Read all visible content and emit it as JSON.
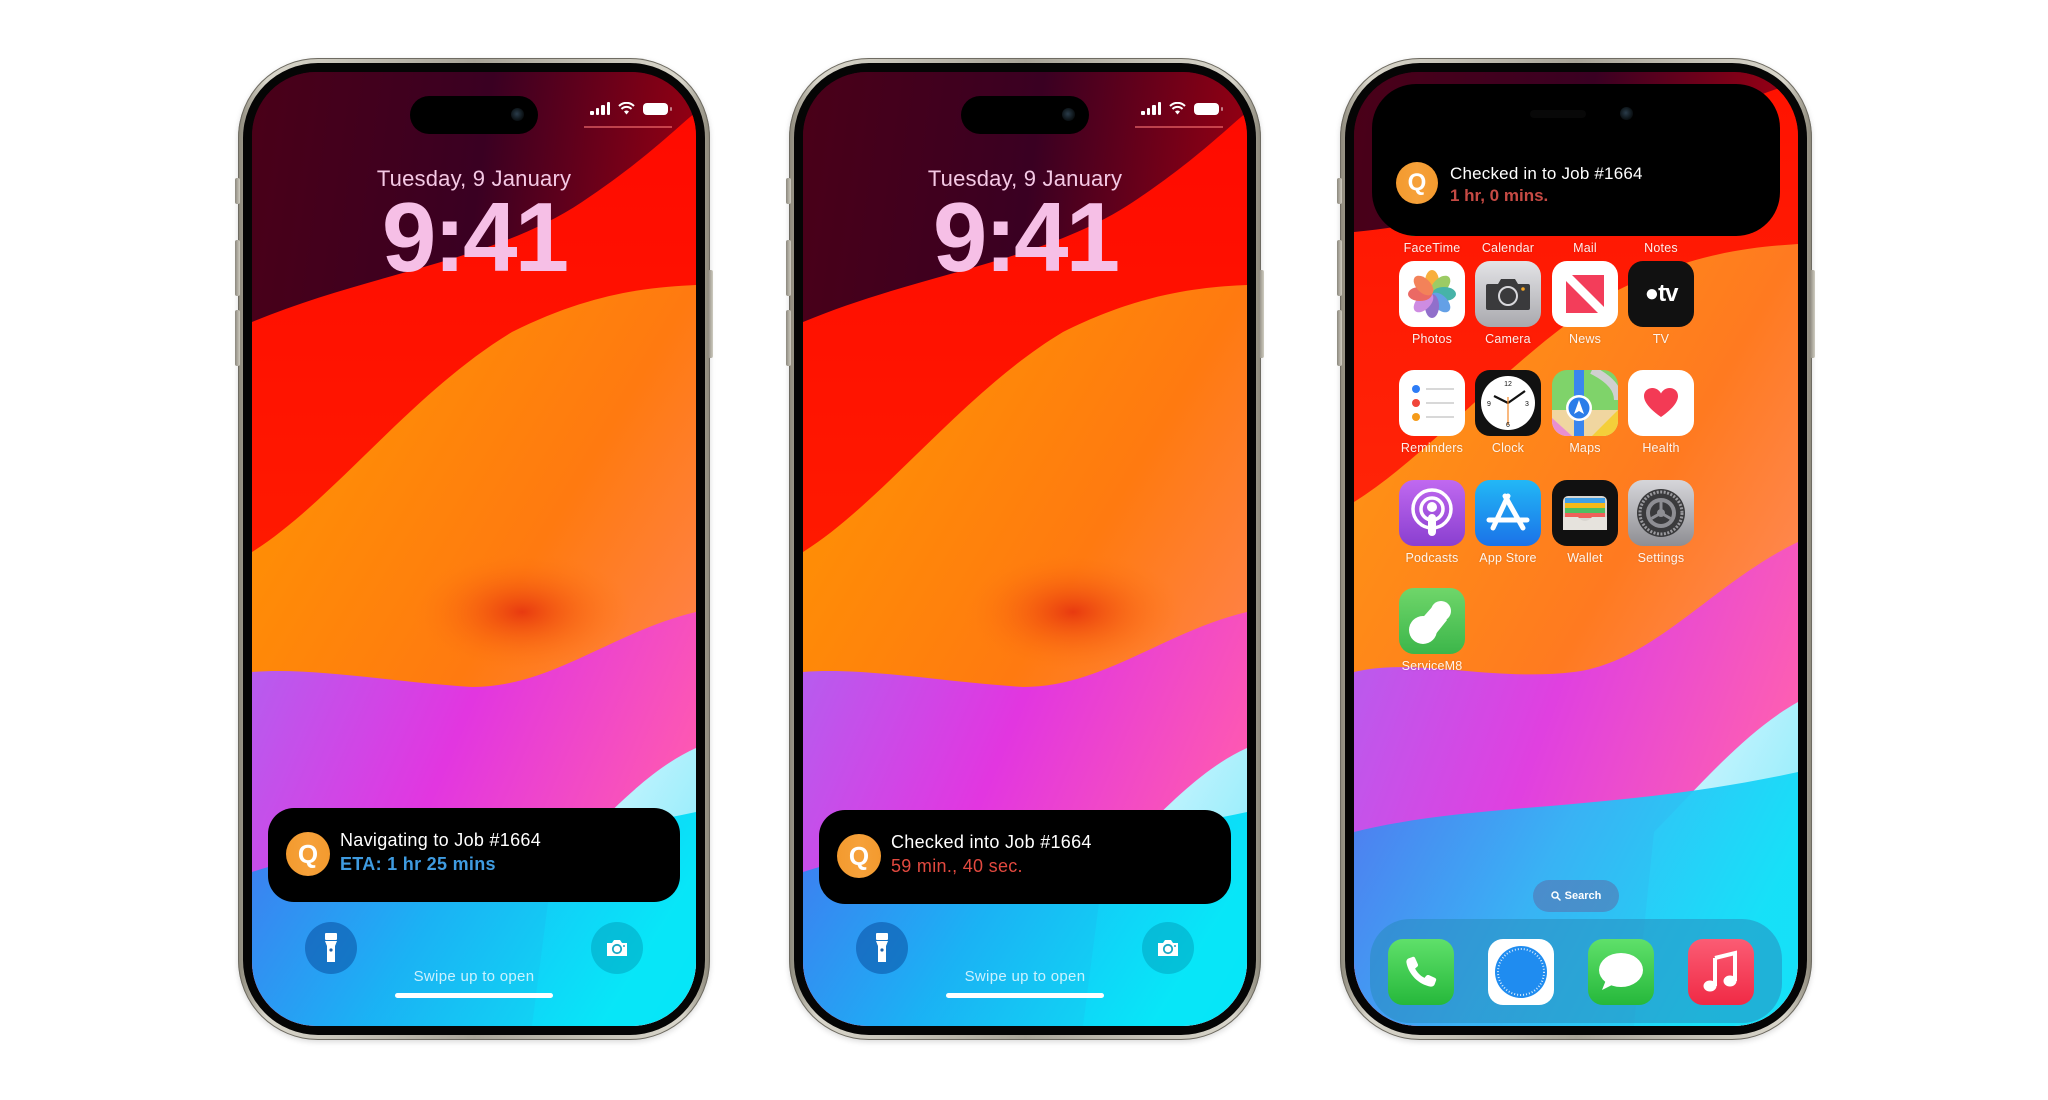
{
  "phones": [
    {
      "screen": "lock",
      "date": "Tuesday, 9 January",
      "time": "9:41",
      "notification": {
        "app_icon_letter": "Q",
        "title": "Navigating to Job #1664",
        "subtitle": "ETA: 1 hr 25 mins",
        "subtitle_color": "#3f9be0"
      },
      "flashlight_icon": "flashlight-icon",
      "camera_icon": "camera-icon",
      "swipe_hint": "Swipe up to open"
    },
    {
      "screen": "lock",
      "date": "Tuesday, 9 January",
      "time": "9:41",
      "notification": {
        "app_icon_letter": "Q",
        "title": "Checked into Job #1664",
        "subtitle": "59 min., 40 sec.",
        "subtitle_color": "#e2493f"
      },
      "flashlight_icon": "flashlight-icon",
      "camera_icon": "camera-icon",
      "swipe_hint": "Swipe up to open"
    },
    {
      "screen": "home",
      "dynamic_island": {
        "app_icon_letter": "Q",
        "title": "Checked in to Job #1664",
        "subtitle": "1 hr, 0 mins.",
        "subtitle_color": "#c64a44"
      },
      "apps": [
        {
          "label": "FaceTime",
          "icon": "facetime-icon"
        },
        {
          "label": "Calendar",
          "icon": "calendar-icon"
        },
        {
          "label": "Mail",
          "icon": "mail-icon"
        },
        {
          "label": "Notes",
          "icon": "notes-icon"
        },
        {
          "label": "Photos",
          "icon": "photos-icon"
        },
        {
          "label": "Camera",
          "icon": "camera-app-icon"
        },
        {
          "label": "News",
          "icon": "news-icon"
        },
        {
          "label": "TV",
          "icon": "tv-icon"
        },
        {
          "label": "Reminders",
          "icon": "reminders-icon"
        },
        {
          "label": "Clock",
          "icon": "clock-icon"
        },
        {
          "label": "Maps",
          "icon": "maps-icon"
        },
        {
          "label": "Health",
          "icon": "health-icon"
        },
        {
          "label": "Podcasts",
          "icon": "podcasts-icon"
        },
        {
          "label": "App Store",
          "icon": "app-store-icon"
        },
        {
          "label": "Wallet",
          "icon": "wallet-icon"
        },
        {
          "label": "Settings",
          "icon": "settings-icon"
        },
        {
          "label": "ServiceM8",
          "icon": "servicem8-icon"
        }
      ],
      "search_label": "Search",
      "dock": [
        {
          "app": "Phone",
          "icon": "phone-icon"
        },
        {
          "app": "Safari",
          "icon": "safari-icon"
        },
        {
          "app": "Messages",
          "icon": "messages-icon"
        },
        {
          "app": "Music",
          "icon": "music-icon"
        }
      ],
      "tv_glyph": "tv"
    }
  ],
  "colors": {
    "app_icon_orange": "#f39a2e",
    "time_pink": "#f6bfe6",
    "eta_blue": "#3f9be0",
    "timer_red": "#e2493f"
  }
}
